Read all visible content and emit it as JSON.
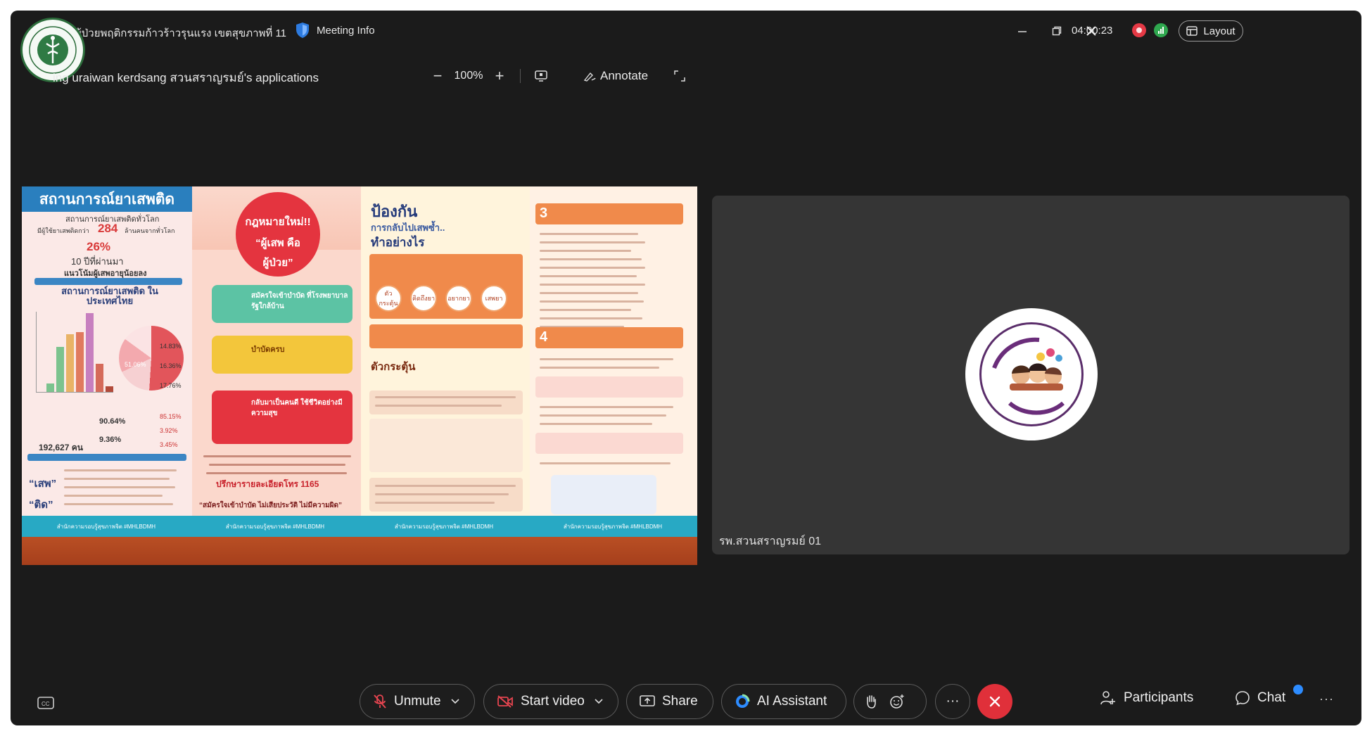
{
  "window": {
    "title": "ผู้ป่วยพฤติกรรมก้าวร้าวรุนแรง เขตสุขภาพที่ 11",
    "meeting_info_label": "Meeting Info",
    "timer": "04:00:23",
    "layout_label": "Layout"
  },
  "share_bar": {
    "viewing_text": "ing uraiwan kerdsang สวนสราญรมย์'s applications",
    "zoom_value": "100%",
    "annotate_label": "Annotate"
  },
  "shared_screen": {
    "p1_title": "สถานการณ์ยาเสพติด",
    "p1_sub": "สถานการณ์ยาเสพติดทั่วโลก",
    "p1_users_prefix": "มีผู้ใช้ยาเสพติดกว่า",
    "p1_users_num": "284",
    "p1_users_unit": "ล้านคนจากทั่วโลก",
    "p1_pct": "26%",
    "p1_years": "10 ปีที่ผ่านมา",
    "p1_young": "แนวโน้มผู้เสพอายุน้อยลง",
    "p1_thai_title": "สถานการณ์ยาเสพติด ในประเทศไทย",
    "p1_pie_pct1": "51.06%",
    "p1_pie_pct2": "16.36%",
    "p1_pie_pct3": "14.83%",
    "p1_pie_pct4": "17.76%",
    "p1_count": "192,627 คน",
    "p1_male": "90.64%",
    "p1_female": "9.36%",
    "p1_stat1": "85.15%",
    "p1_stat2": "3.92%",
    "p1_stat3": "3.45%",
    "p1_word1": "“เสพ”",
    "p1_word2": "“ติด”",
    "p2_circle_l1": "กฎหมายใหม่!!",
    "p2_circle_l2": "“ผู้เสพ คือ",
    "p2_circle_l3": "ผู้ป่วย”",
    "p2_tag1": "สมัครใจเข้าบำบัด ที่โรงพยาบาลรัฐใกล้บ้าน",
    "p2_tag2": "บำบัดครบ",
    "p2_tag3": "กลับมาเป็นคนดี ใช้ชีวิตอย่างมีความสุข",
    "p2_hotline": "ปรึกษารายละเอียดโทร 1165",
    "p2_slogan": "“สมัครใจเข้าบำบัด ไม่เสียประวัติ ไม่มีความผิด”",
    "p3_title1": "ป้องกัน",
    "p3_title2": "การกลับไปเสพซ้ำ..",
    "p3_title3": "ทำอย่างไร",
    "p3_pill1": "ตัวกระตุ้น",
    "p3_pill2": "คิดถึงยา",
    "p3_pill3": "อยากยา",
    "p3_pill4": "เสพยา",
    "p3_trigger": "ตัวกระตุ้น",
    "p4_num3": "3",
    "p4_num4": "4",
    "footer_label": "สำนักความรอบรู้สุขภาพจิต #MHLBDMH"
  },
  "participant": {
    "name": "รพ.สวนสราญรมย์ 01"
  },
  "toolbar": {
    "unmute_label": "Unmute",
    "start_video_label": "Start video",
    "share_label": "Share",
    "ai_label": "AI Assistant",
    "more_label": "···",
    "participants_label": "Participants",
    "chat_label": "Chat",
    "more_right_label": "···"
  },
  "colors": {
    "window_bg": "#1b1b1b",
    "tile_bg": "#353535",
    "leave_red": "#e0303a",
    "record_red": "#e53945",
    "signal_green": "#2fa84f",
    "accent_blue": "#2d8cff"
  },
  "icons": [
    "shield-icon",
    "record-icon",
    "signal-icon",
    "layout-icon",
    "minimize-icon",
    "restore-icon",
    "close-icon",
    "zoom-out-icon",
    "zoom-in-icon",
    "screen-icon",
    "annotate-icon",
    "fullscreen-icon",
    "captions-icon",
    "mic-muted-icon",
    "video-off-icon",
    "share-screen-icon",
    "ai-assistant-icon",
    "raise-hand-icon",
    "reaction-icon",
    "leave-icon",
    "participants-icon",
    "chat-icon"
  ]
}
